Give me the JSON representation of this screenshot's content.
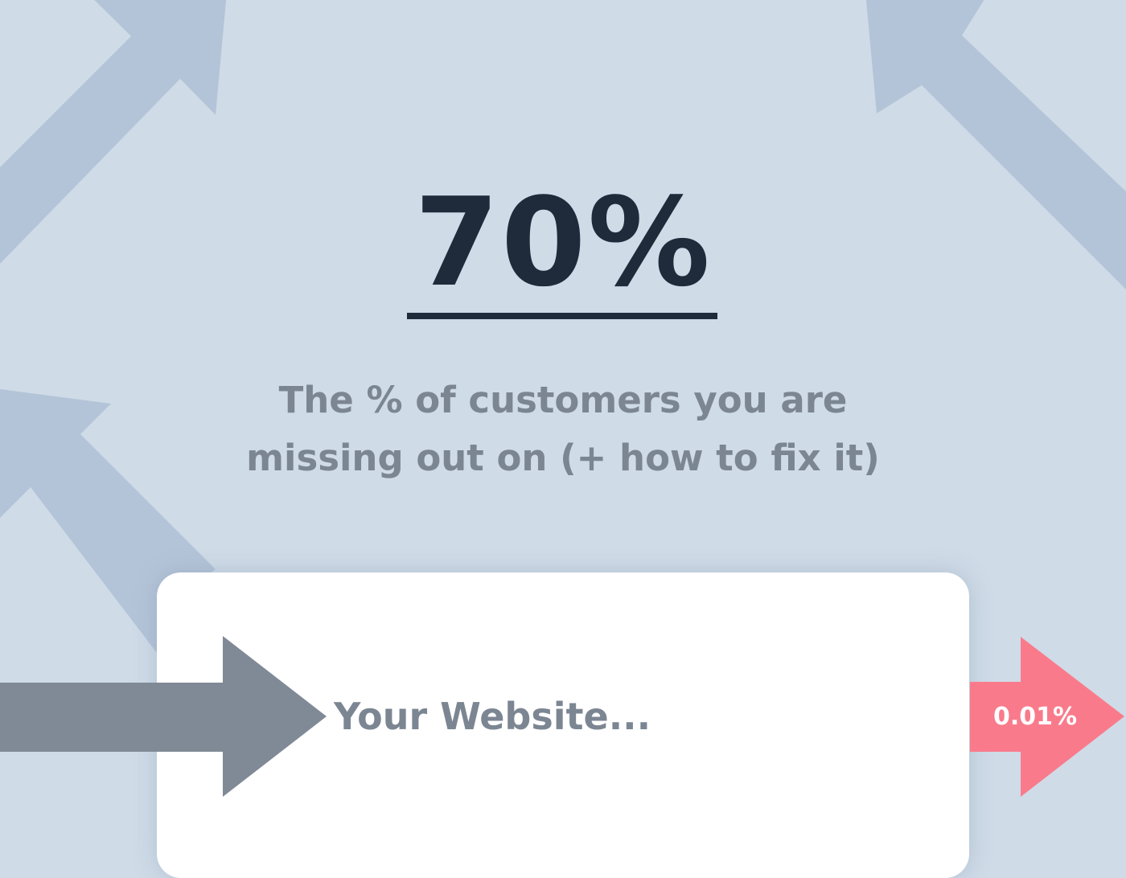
{
  "headline": {
    "value": "70%"
  },
  "subheading": {
    "line1": "The % of customers you are",
    "line2": "missing out on (+ how to fix it)"
  },
  "card": {
    "label": "Your Website..."
  },
  "output_arrow": {
    "label": "0.01%"
  },
  "colors": {
    "background": "#cfdbe7",
    "decorative_arrow": "#b4c4d8",
    "headline": "#1f2b3a",
    "subheading": "#7c8693",
    "input_arrow": "#808a96",
    "output_arrow": "#f97b8b",
    "card": "#ffffff"
  },
  "icons": {
    "background_arrows": "arrow-up-right-icon",
    "input_arrow": "arrow-right-icon",
    "output_arrow": "arrow-right-icon"
  }
}
